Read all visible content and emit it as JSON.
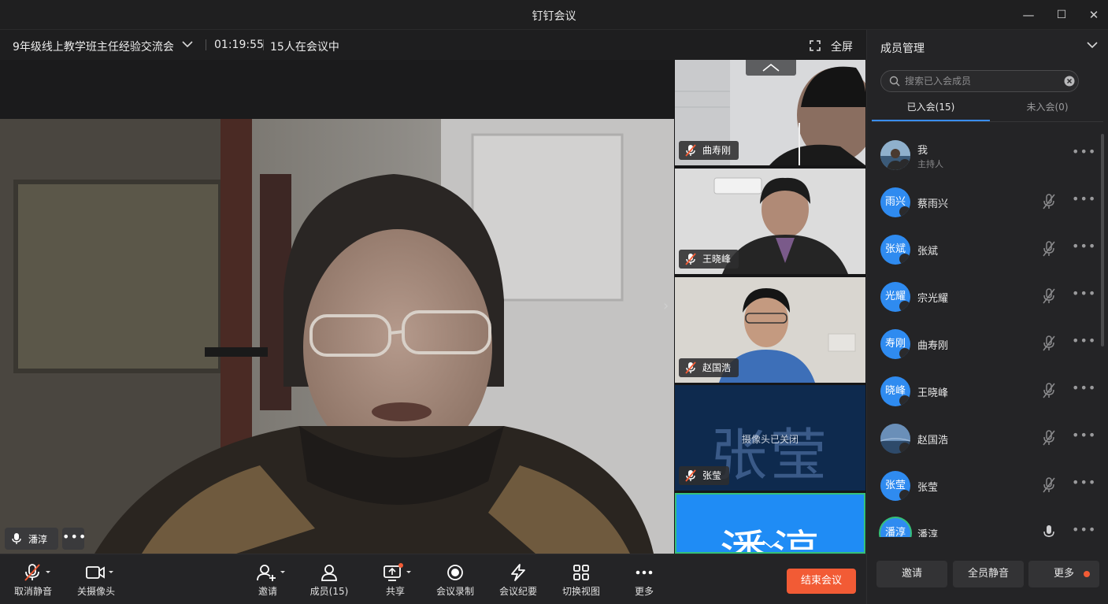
{
  "window": {
    "title": "钉钉会议",
    "minimize": "—",
    "maximize": "☐",
    "close": "✕"
  },
  "meeting": {
    "topic": "9年级线上教学班主任经验交流会",
    "elapsed": "01:19:55",
    "participants_status": "15人在会议中",
    "fullscreen_label": "全屏"
  },
  "active_speaker": {
    "name": "潘淳",
    "more": "•••"
  },
  "thumbnails": [
    {
      "name": "曲寿刚",
      "camera": "on"
    },
    {
      "name": "王晓峰",
      "camera": "on"
    },
    {
      "name": "赵国浩",
      "camera": "on"
    },
    {
      "name": "张莹",
      "camera": "off",
      "avatar_text": "张莹",
      "camera_off_text": "摄像头已关闭"
    },
    {
      "name": "潘淳",
      "camera": "off",
      "avatar_text": "潘淳"
    }
  ],
  "toolbar": {
    "unmute": "取消静音",
    "camera_off": "关摄像头",
    "invite": "邀请",
    "members": "成员(15)",
    "share": "共享",
    "record": "会议录制",
    "minutes": "会议纪要",
    "switch_view": "切换视图",
    "more": "更多",
    "end_meeting": "结束会议"
  },
  "panel": {
    "title": "成员管理",
    "search_placeholder": "搜索已入会成员",
    "tab_joined": "已入会(15)",
    "tab_not_joined": "未入会(0)",
    "members": [
      {
        "avatar": "",
        "name": "我",
        "role": "主持人",
        "mic": "none"
      },
      {
        "avatar": "雨兴",
        "name": "蔡雨兴",
        "role": "",
        "mic": "muted"
      },
      {
        "avatar": "张斌",
        "name": "张斌",
        "role": "",
        "mic": "muted"
      },
      {
        "avatar": "光耀",
        "name": "宗光耀",
        "role": "",
        "mic": "muted"
      },
      {
        "avatar": "寿刚",
        "name": "曲寿刚",
        "role": "",
        "mic": "muted"
      },
      {
        "avatar": "晓峰",
        "name": "王晓峰",
        "role": "",
        "mic": "muted"
      },
      {
        "avatar": "",
        "name": "赵国浩",
        "role": "",
        "mic": "muted"
      },
      {
        "avatar": "张莹",
        "name": "张莹",
        "role": "",
        "mic": "muted"
      },
      {
        "avatar": "潘淳",
        "name": "潘淳",
        "role": "",
        "mic": "on"
      }
    ],
    "btn_invite": "邀请",
    "btn_mute_all": "全员静音",
    "btn_more": "更多",
    "more_icon": "•••"
  },
  "colors": {
    "accent": "#2f8bf0",
    "end": "#f25b35",
    "panel_bg": "#242426",
    "stage_bg": "#1b1b1c"
  }
}
